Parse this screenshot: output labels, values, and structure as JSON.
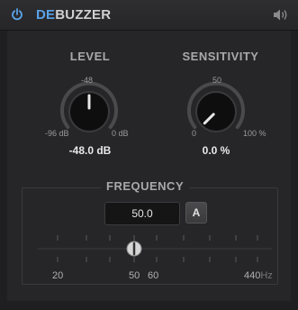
{
  "header": {
    "title_part1": "DE",
    "title_part2": "BUZZER",
    "power_icon": "power-icon",
    "speaker_icon": "speaker-icon"
  },
  "level": {
    "label": "LEVEL",
    "min_label": "-96 dB",
    "mid_label": "-48",
    "max_label": "0 dB",
    "value": "-48.0 dB",
    "level_fraction": 0.5
  },
  "sensitivity": {
    "label": "SENSITIVITY",
    "min_label": "0",
    "mid_label": "50",
    "max_label": "100 %",
    "value": "0.0 %",
    "level_fraction": 0.0
  },
  "frequency": {
    "label": "FREQUENCY",
    "value": "50.0",
    "auto_button": "A",
    "scale_labels": [
      "20",
      "50",
      "60",
      "440"
    ],
    "unit": "Hz",
    "slider_value_hz": 50
  },
  "colors": {
    "accent": "#5aa2e8",
    "background": "#1f1f21",
    "panel": "#262628"
  }
}
